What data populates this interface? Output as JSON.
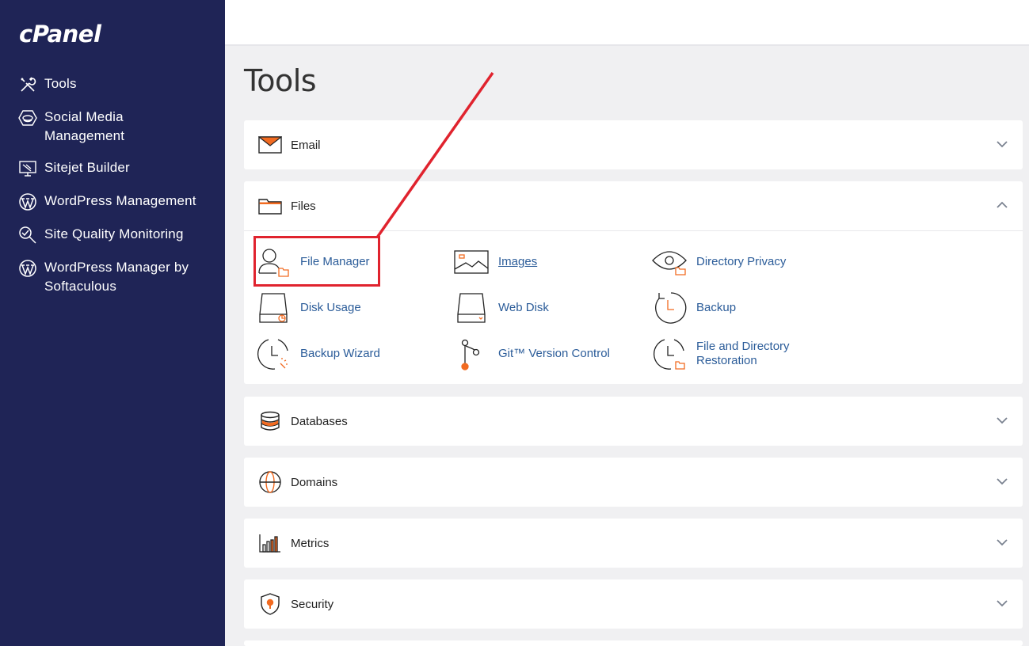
{
  "app": {
    "logo_text": "cPanel",
    "page_title": "Tools"
  },
  "sidebar": {
    "items": [
      {
        "label": "Tools",
        "icon": "tools-icon"
      },
      {
        "label": "Social Media\nManagement",
        "icon": "social-media-icon"
      },
      {
        "label": "Sitejet Builder",
        "icon": "sitejet-icon"
      },
      {
        "label": "WordPress Management",
        "icon": "wordpress-icon"
      },
      {
        "label": "Site Quality Monitoring",
        "icon": "magnifier-check-icon"
      },
      {
        "label": "WordPress Manager by\nSoftaculous",
        "icon": "wordpress-icon"
      }
    ]
  },
  "sections": {
    "email": {
      "title": "Email",
      "icon": "envelope-icon",
      "state": "collapsed"
    },
    "files": {
      "title": "Files",
      "icon": "folder-icon",
      "state": "expanded"
    },
    "databases": {
      "title": "Databases",
      "icon": "database-icon",
      "state": "collapsed"
    },
    "domains": {
      "title": "Domains",
      "icon": "globe-icon",
      "state": "collapsed"
    },
    "metrics": {
      "title": "Metrics",
      "icon": "bar-chart-icon",
      "state": "collapsed"
    },
    "security": {
      "title": "Security",
      "icon": "shield-icon",
      "state": "collapsed"
    }
  },
  "files_tools": {
    "file_manager": "File Manager",
    "images": "Images",
    "directory_privacy": "Directory Privacy",
    "disk_usage": "Disk Usage",
    "web_disk": "Web Disk",
    "backup": "Backup",
    "backup_wizard": "Backup Wizard",
    "git_version_control": "Git™ Version Control",
    "file_restoration_line1": "File and Directory",
    "file_restoration_line2": "Restoration"
  },
  "colors": {
    "sidebar_bg": "#1f2456",
    "accent_orange": "#f26b21",
    "link_blue": "#2b5c99",
    "annotation_red": "#e0232e"
  }
}
